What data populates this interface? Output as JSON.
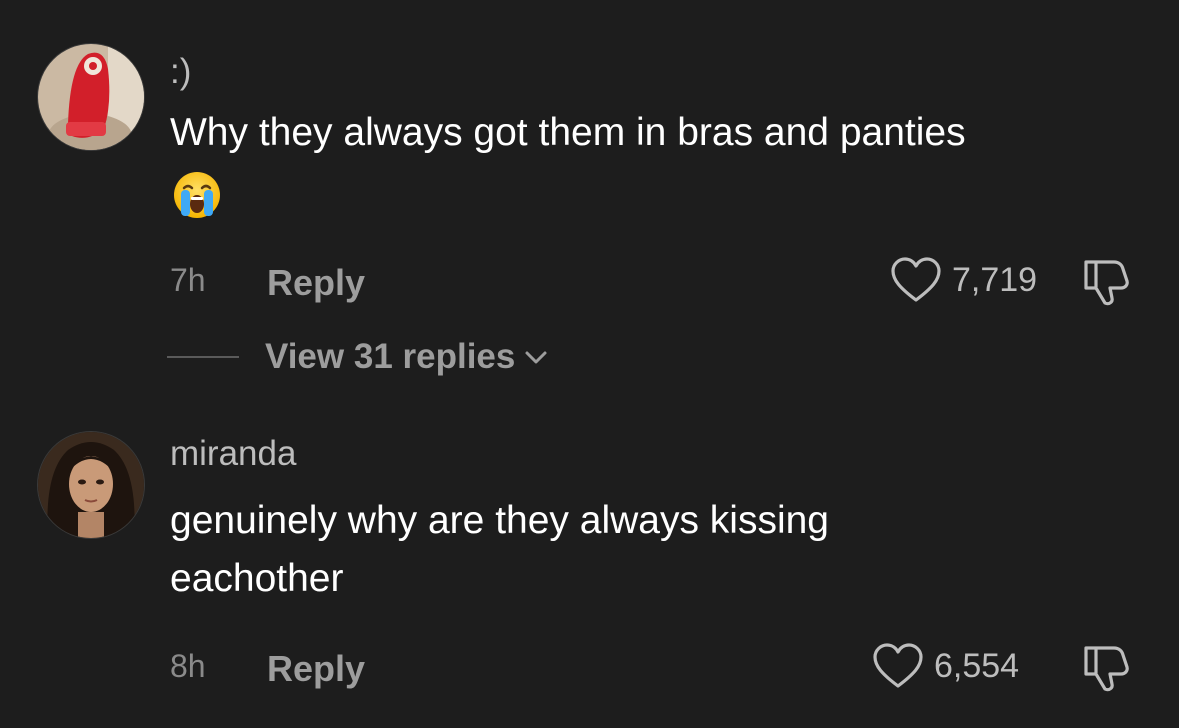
{
  "comments": [
    {
      "username": ":)",
      "text": "Why they always got them in bras and panties",
      "emoji": "loudly-crying-face",
      "time": "7h",
      "reply_label": "Reply",
      "likes": "7,719",
      "view_replies": "View 31 replies"
    },
    {
      "username": "miranda",
      "text": "genuinely why are they always kissing eachother",
      "time": "8h",
      "reply_label": "Reply",
      "likes": "6,554"
    }
  ],
  "colors": {
    "background": "#1d1d1d",
    "primary_text": "#ffffff",
    "secondary_text": "#9d9d9d"
  }
}
